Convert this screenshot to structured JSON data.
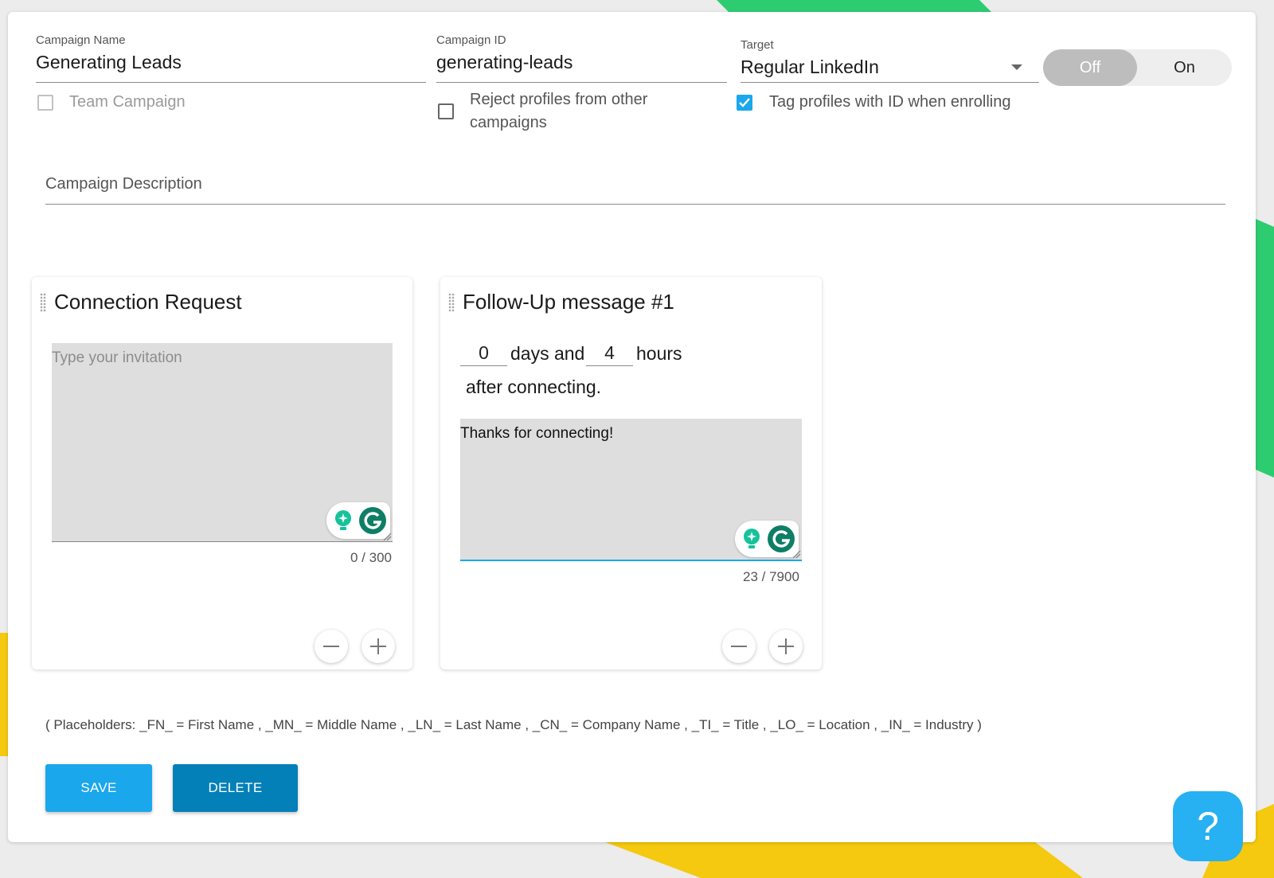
{
  "form": {
    "campaign_name": {
      "label": "Campaign Name",
      "value": "Generating Leads"
    },
    "campaign_id": {
      "label": "Campaign ID",
      "value": "generating-leads"
    },
    "target": {
      "label": "Target",
      "value": "Regular LinkedIn"
    },
    "toggle": {
      "off_label": "Off",
      "on_label": "On",
      "state": "off"
    },
    "team_campaign": {
      "label": "Team Campaign",
      "checked": false,
      "disabled": true
    },
    "reject_profiles": {
      "label_line1": "Reject profiles from other",
      "label_line2": "campaigns",
      "checked": false
    },
    "tag_profiles": {
      "label": "Tag profiles with ID when enrolling",
      "checked": true
    },
    "description": {
      "placeholder": "Campaign Description"
    }
  },
  "cards": {
    "connection": {
      "title": "Connection Request",
      "placeholder": "Type your invitation",
      "counter": "0 / 300"
    },
    "followup": {
      "title": "Follow-Up message #1",
      "days": "0",
      "days_label": "days and",
      "hours": "4",
      "hours_label": "hours",
      "after_label": "after connecting.",
      "message": "Thanks for connecting!",
      "counter": "23 / 7900"
    }
  },
  "placeholders_note": "( Placeholders: _FN_ = First Name , _MN_ = Middle Name , _LN_ = Last Name , _CN_ = Company Name , _TI_ = Title , _LO_ = Location , _IN_ = Industry )",
  "buttons": {
    "save": "SAVE",
    "delete": "DELETE",
    "help": "?"
  },
  "colors": {
    "accent": "#1aa7ec",
    "delete": "#0480b8",
    "green": "#2ecc71",
    "yellow": "#f5c90f",
    "grammarly": "#15c39a"
  }
}
